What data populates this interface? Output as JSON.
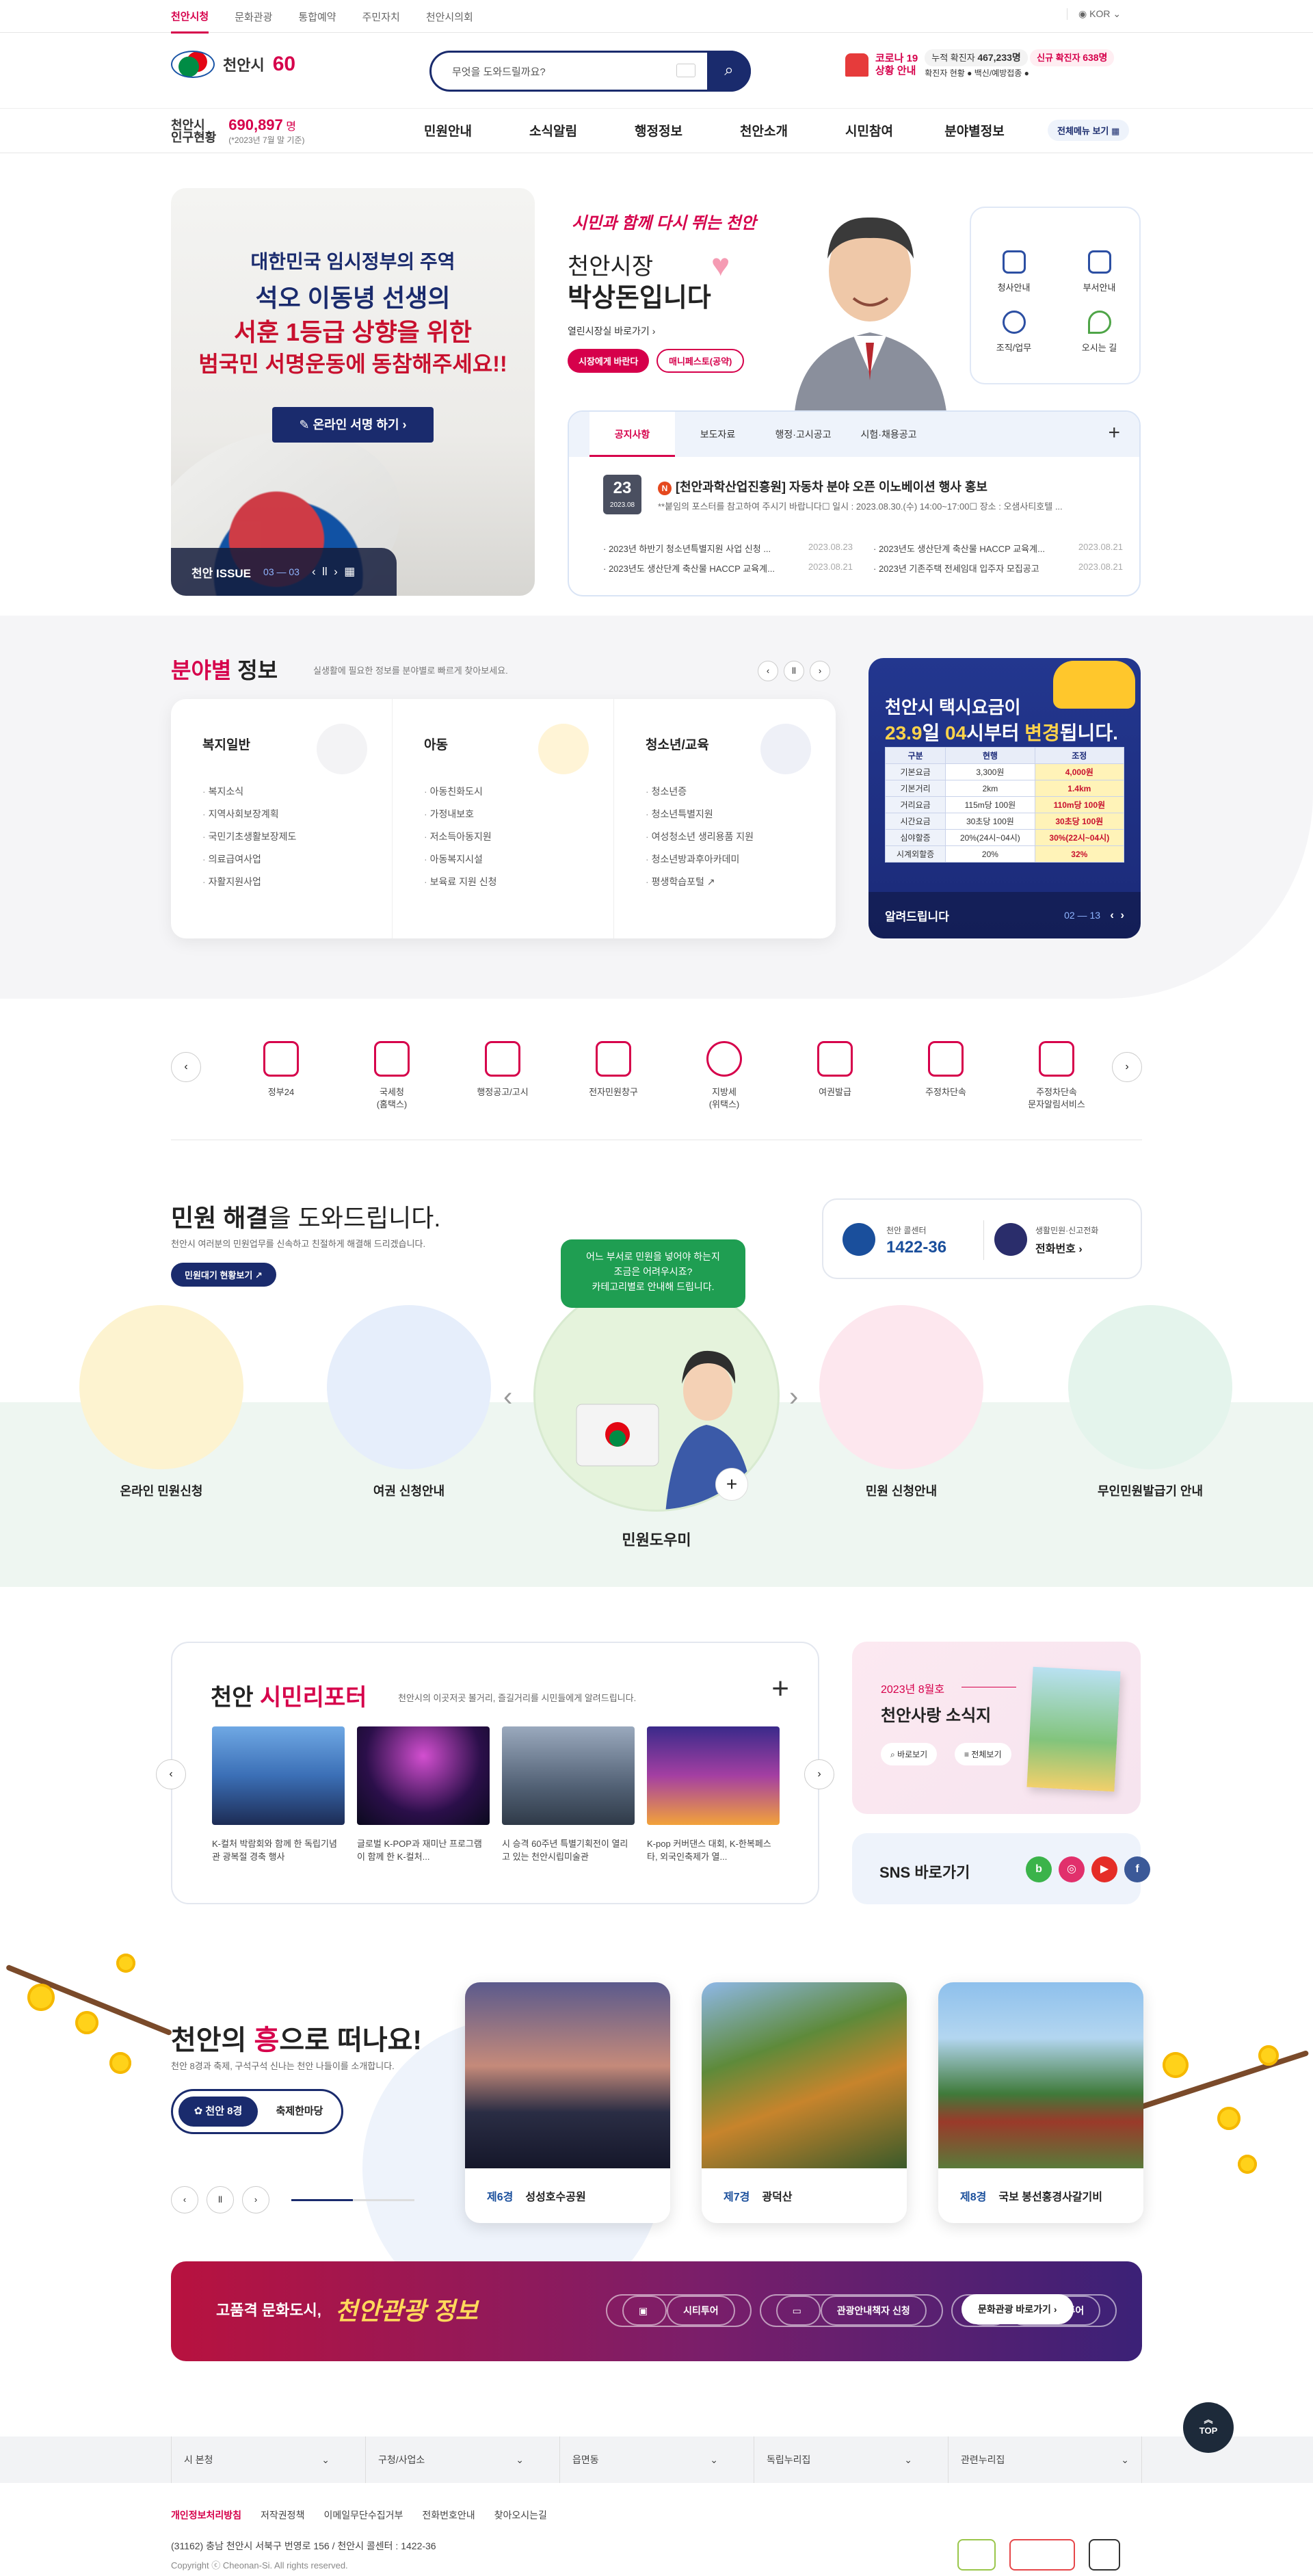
{
  "topbar": {
    "tabs": [
      "천안시청",
      "문화관광",
      "통합예약",
      "주민자치",
      "천안시의회"
    ],
    "lang": "KOR"
  },
  "header": {
    "logo_text": "천안시",
    "anniversary": "60",
    "search_placeholder": "무엇을 도와드릴까요?",
    "covid_title_1": "코로나 19",
    "covid_title_2": "상황 안내",
    "covid_total_label": "누적 확진자",
    "covid_total": "467,233명",
    "covid_new_label": "신규 확진자",
    "covid_new": "638명",
    "covid_status": "확진자 현황",
    "vaccine": "백신/예방접종"
  },
  "nav": {
    "population_label_1": "천안시",
    "population_label_2": "인구현황",
    "population": "690,897",
    "population_unit": "명",
    "population_note": "(*2023년 7월 말 기준)",
    "menu": [
      "민원안내",
      "소식알림",
      "행정정보",
      "천안소개",
      "시민참여",
      "분야별정보"
    ],
    "all_menu": "전체메뉴 보기"
  },
  "banner": {
    "line1": "대한민국 임시정부의 주역",
    "line2": "석오 이동녕 선생의",
    "line3": "서훈 1등급 상향을 위한",
    "line4": "범국민 서명운동에 동참해주세요!!",
    "button": "온라인 서명 하기",
    "issue_label": "천안 ISSUE",
    "issue_page": "03 — 03"
  },
  "mayor": {
    "slogan": "시민과 함께 다시 뛰는 천안",
    "title1": "천안시장",
    "title2": "박상돈입니다",
    "link": "열린시장실 바로가기",
    "btn1": "시장에게 바란다",
    "btn2": "매니페스토(공약)"
  },
  "quick_menu": [
    "청사안내",
    "부서안내",
    "조직/업무",
    "오시는 길"
  ],
  "notice": {
    "tabs": [
      "공지사항",
      "보도자료",
      "행정·고시공고",
      "시험·채용공고"
    ],
    "day": "23",
    "date": "2023.08",
    "badge": "N",
    "title": "[천안과학산업진흥원] 자동차 분야 오픈 이노베이션 행사 홍보",
    "desc": "**붙임의 포스터를 참고하여 주시기 바랍니다☐ 일시 : 2023.08.30.(수) 14:00~17:00☐ 장소 : 오샘사티호텔 ...",
    "items": [
      {
        "text": "· 2023년 하반기 청소년특별지원 사업 신청 ...",
        "date": "2023.08.23"
      },
      {
        "text": "· 2023년도 생산단계 축산물 HACCP 교육계...",
        "date": "2023.08.21"
      },
      {
        "text": "· 2023년도 생산단계 축산물 HACCP 교육계...",
        "date": "2023.08.21"
      },
      {
        "text": "· 2023년 기존주택 전세임대 입주자 모집공고",
        "date": "2023.08.21"
      }
    ]
  },
  "field": {
    "title_red": "분야별",
    "title_black": "정보",
    "subtitle": "실생활에 필요한 정보를 분야별로 빠르게 찾아보세요.",
    "cards": [
      {
        "title": "복지일반",
        "items": [
          "복지소식",
          "지역사회보장계획",
          "국민기초생활보장제도",
          "의료급여사업",
          "자활지원사업"
        ]
      },
      {
        "title": "아동",
        "items": [
          "아동친화도시",
          "가정내보호",
          "저소득아동지원",
          "아동복지시설",
          "보육료 지원 신청"
        ]
      },
      {
        "title": "청소년/교육",
        "items": [
          "청소년증",
          "청소년특별지원",
          "여성청소년 생리용품 지원",
          "청소년방과후아카데미",
          "평생학습포털 ↗"
        ]
      }
    ]
  },
  "taxi": {
    "line1": "천안시 택시요금이",
    "line2_pre": "23.9",
    "line2_mid": "일 ",
    "line2_time": "04",
    "line2_post": "시부터 ",
    "line2_bold": "변경",
    "line2_end": "됩니다.",
    "headers": [
      "구분",
      "현행",
      "조정"
    ],
    "rows": [
      [
        "기본요금",
        "3,300원",
        "4,000원"
      ],
      [
        "기본거리",
        "2km",
        "1.4km"
      ],
      [
        "거리요금",
        "115m당 100원",
        "110m당 100원"
      ],
      [
        "시간요금",
        "30초당 100원",
        "30초당 100원"
      ],
      [
        "심야할증",
        "20%(24시~04시)",
        "30%(22시~04시)"
      ],
      [
        "시계외할증",
        "20%",
        "32%"
      ]
    ],
    "footer": "알려드립니다",
    "page": "02 — 13"
  },
  "services": [
    {
      "l1": "정부24",
      "l2": ""
    },
    {
      "l1": "국세청",
      "l2": "(홈택스)"
    },
    {
      "l1": "행정공고/고시",
      "l2": ""
    },
    {
      "l1": "전자민원창구",
      "l2": ""
    },
    {
      "l1": "지방세",
      "l2": "(위택스)"
    },
    {
      "l1": "여권발급",
      "l2": ""
    },
    {
      "l1": "주정차단속",
      "l2": ""
    },
    {
      "l1": "주정차단속",
      "l2": "문자알림서비스"
    }
  ],
  "civil": {
    "title_bold": "민원 해결",
    "title_rest": "을 도와드립니다.",
    "subtitle": "천안시 여러분의 민원업무를 신속하고 친절하게 해결해 드리겠습니다.",
    "button": "민원대기 현황보기",
    "call1_label": "천안 콜센터",
    "call1_number": "1422-36",
    "call2_label": "생활민원·신고전화",
    "call2_text": "전화번호",
    "bubble": [
      "어느 부서로 민원을 넣어야 하는지",
      "조금은 어려우시죠?",
      "카테고리별로 안내해 드립니다."
    ],
    "items": [
      "온라인 민원신청",
      "여권 신청안내",
      "민원도우미",
      "민원 신청안내",
      "무인민원발급기 안내"
    ]
  },
  "reporter": {
    "title_black": "천안",
    "title_red": "시민리포터",
    "subtitle": "천안시의 이곳저곳 볼거리, 즐길거리를 시민들에게 알려드립니다.",
    "items": [
      {
        "caption": "K-컬처 박람회와 함께 한 독립기념관 광복절 경축 행사"
      },
      {
        "caption": "글로벌 K-POP과 재미난 프로그램이 함께 한 K-컬처..."
      },
      {
        "caption": "시 승격 60주년 특별기획전이 열리고 있는 천안시립미술관"
      },
      {
        "caption": "K-pop 커버댄스 대회, K-한복페스타, 외국인축제가 열..."
      }
    ]
  },
  "newsletter": {
    "issue": "2023년 8월호",
    "title": "천안사랑 소식지",
    "btn1": "바로보기",
    "btn2": "전체보기"
  },
  "sns": {
    "title": "SNS 바로가기",
    "icons": [
      {
        "name": "blog",
        "glyph": "b",
        "color": "#3bb34a"
      },
      {
        "name": "instagram",
        "glyph": "◎",
        "color": "#e1306c"
      },
      {
        "name": "youtube",
        "glyph": "▶",
        "color": "#e52d27"
      },
      {
        "name": "facebook",
        "glyph": "f",
        "color": "#3b5998"
      }
    ]
  },
  "tour": {
    "title_pre": "천안의 ",
    "title_post": "으로 떠나요!",
    "subtitle": "천안 8경과 축제, 구석구석 신나는 천안 나들이를 소개합니다.",
    "tab1": "천안 8경",
    "tab2": "축제한마당",
    "cards": [
      {
        "num": "제6경",
        "name": "성성호수공원"
      },
      {
        "num": "제7경",
        "name": "광덕산"
      },
      {
        "num": "제8경",
        "name": "국보 봉선홍경사갈기비"
      }
    ]
  },
  "culture": {
    "title": "고품격 문화도시,",
    "title2": "천안관광 정보",
    "buttons": [
      "시티투어",
      "관광안내책자 신청",
      "3D 사이버투어"
    ],
    "go": "문화관광 바로가기"
  },
  "footer": {
    "top": "TOP",
    "selects": [
      "시 본청",
      "구청/사업소",
      "읍면동",
      "독립누리집",
      "관련누리집"
    ],
    "links": [
      "개인정보처리방침",
      "저작권정책",
      "이메일무단수집거부",
      "전화번호안내",
      "찾아오시는길"
    ],
    "address": "(31162) 충남 천안시 서북구 번영로 156 / 천안시 콜센터 : 1422-36",
    "copyright": "Copyright ⓒ Cheonan-Si. All rights reserved."
  }
}
